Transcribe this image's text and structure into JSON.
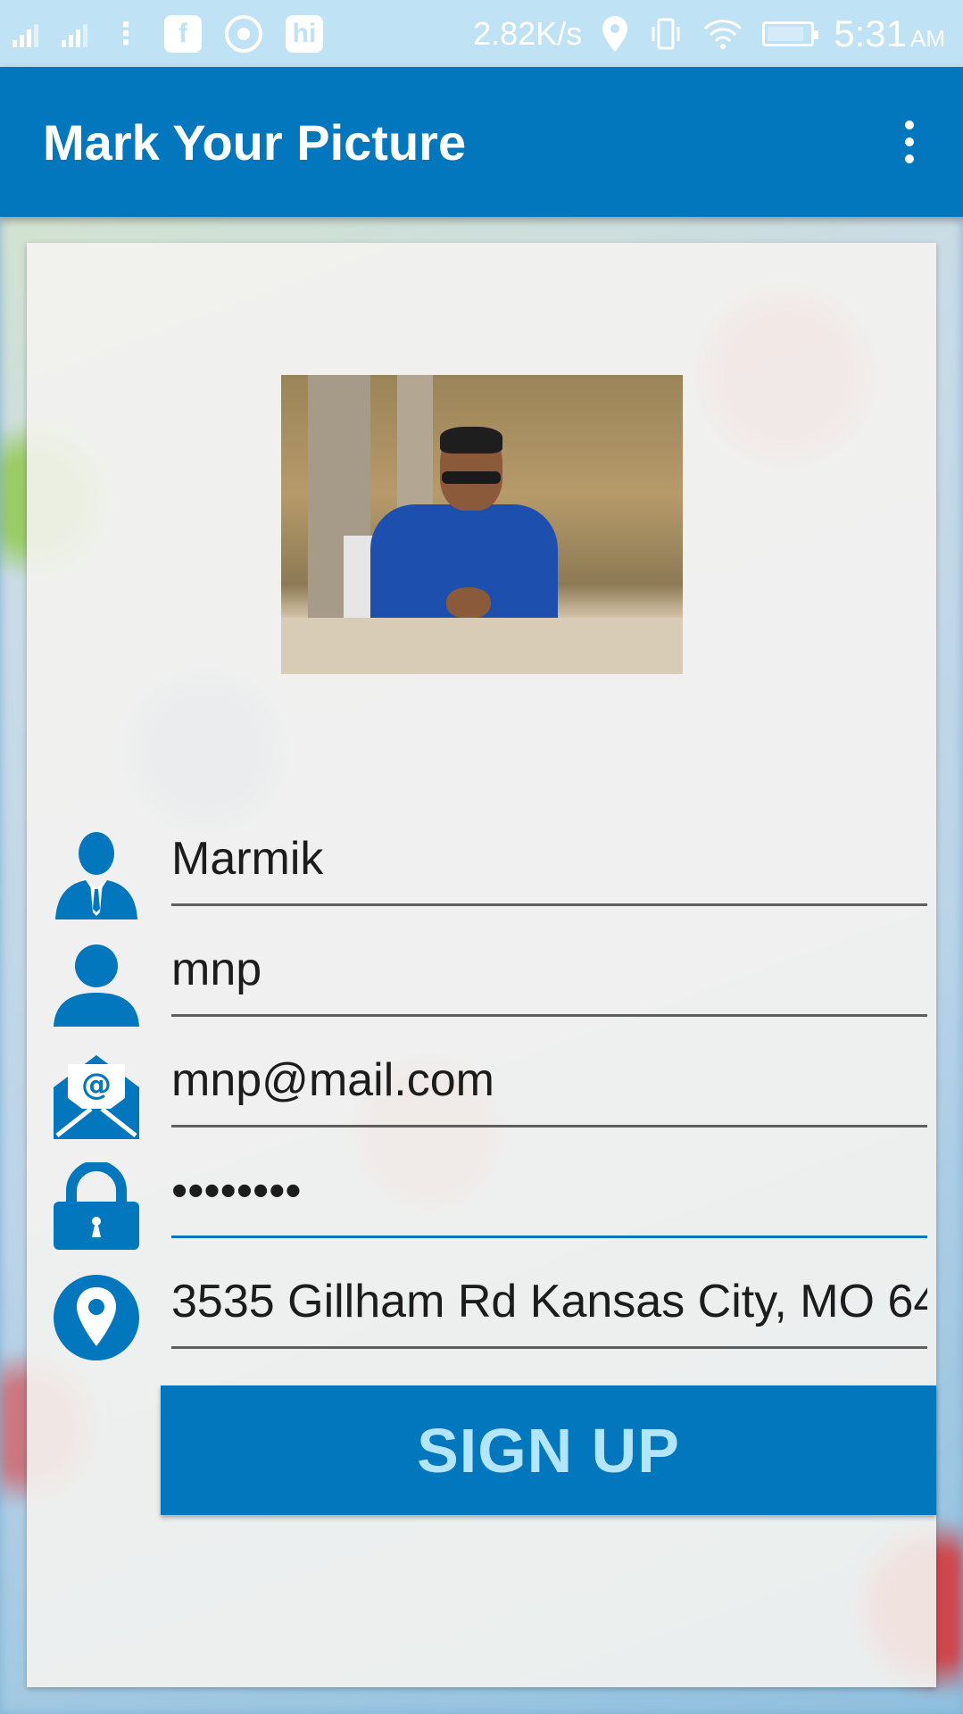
{
  "status_bar": {
    "network_speed": "2.82K/s",
    "time": "5:31",
    "ampm": "AM",
    "notification_apps": [
      "facebook-icon",
      "whatsapp-icon",
      "hike-icon"
    ],
    "hike_label": "hi"
  },
  "app_bar": {
    "title": "Mark Your Picture",
    "menu_icon": "overflow-menu-icon"
  },
  "form": {
    "name": {
      "icon": "business-person-icon",
      "value": "Marmik"
    },
    "username": {
      "icon": "person-icon",
      "value": "mnp"
    },
    "email": {
      "icon": "mail-icon",
      "value": "mnp@mail.com"
    },
    "password": {
      "icon": "lock-icon",
      "value": "••••••••"
    },
    "address": {
      "icon": "location-pin-icon",
      "value": "3535 Gillham Rd Kansas City, MO 64"
    }
  },
  "signup_label": "SIGN UP",
  "colors": {
    "primary": "#0277bd",
    "status_bar": "#bfe2f5",
    "button_text": "#b3e5fc"
  }
}
